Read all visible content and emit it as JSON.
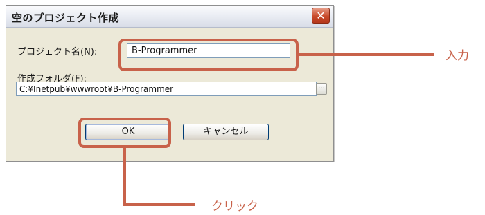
{
  "dialog": {
    "title": "空のプロジェクト作成",
    "close_symbol": "✕",
    "project_name_label": "プロジェクト名(N):",
    "project_name_value": "B-Programmer",
    "folder_label": "作成フォルダ(F):",
    "folder_value": "C:¥Inetpub¥wwwroot¥B-Programmer",
    "browse_label": "...",
    "ok_label": "OK",
    "cancel_label": "キャンセル"
  },
  "annotations": {
    "input_callout": "入力",
    "click_callout": "クリック",
    "highlight_color": "#c8624a"
  }
}
